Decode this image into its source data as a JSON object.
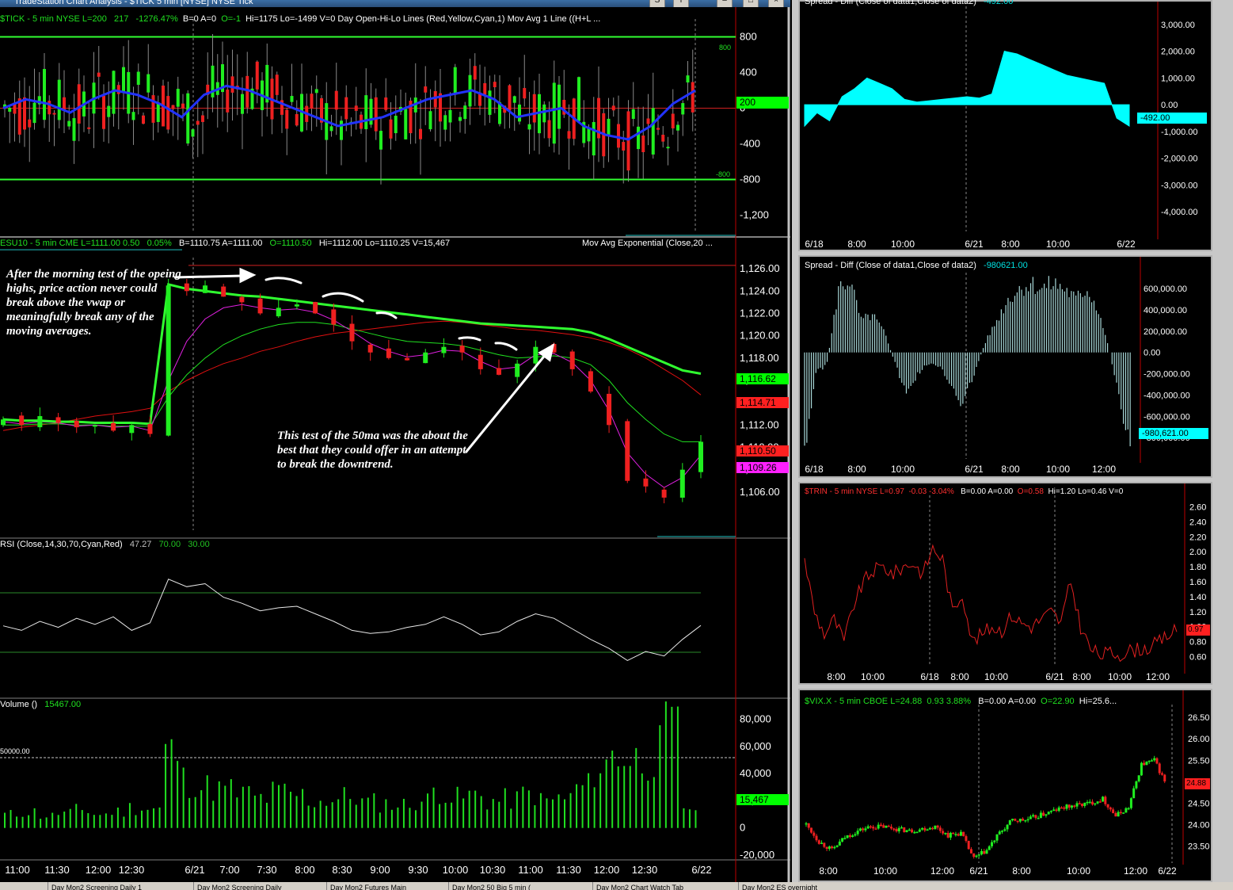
{
  "window": {
    "title": "TradeStation Chart Analysis - $TICK 5 min [NYSE] NYSE Tick",
    "btn_s": "S",
    "btn_i": "i"
  },
  "tabs": [
    "Day Mon2 Screening Daily 1",
    "Day Mon2 Screening Daily",
    "Day Mon2 Futures Main",
    "Day Mon2 50 Big 5 min (",
    "Day Mon2 Chart Watch Tab",
    "Day Mon2 ES overnight"
  ],
  "tick_panel": {
    "header_symbol": "$TICK - 5 min  NYSE  L=200",
    "header_change": "217",
    "header_pct": "-1276.47%",
    "header_rest": "B=0  A=0",
    "header_o": "O=-1",
    "header_hilo": "Hi=1175  Lo=-1499  V=0  Day Open-Hi-Lo Lines (Red,Yellow,Cyan,1)   Mov Avg 1 Line ((H+L ...",
    "ticks": [
      "800",
      "400",
      "0",
      "-400",
      "-800",
      "-1,200"
    ],
    "line_label_top": "800",
    "line_label_bottom": "-800",
    "last_badge": "200"
  },
  "es_panel": {
    "header_symbol": "ESU10 - 5 min  CME  L=1111.00  0.50",
    "header_pct": "0.05%",
    "header_rest": "B=1110.75  A=1111.00",
    "header_o": "O=1110.50",
    "header_hilo": "Hi=1112.00  Lo=1110.25  V=15,467",
    "header_ma": "Mov Avg Exponential (Close,20 ...",
    "ticks": [
      "1,126.00",
      "1,124.00",
      "1,122.00",
      "1,120.00",
      "1,118.00",
      "1,116.00",
      "1,114.00",
      "1,112.00",
      "1,110.00",
      "1,108.00",
      "1,106.00"
    ],
    "badges": {
      "green": "1,116.62",
      "red": "1,114.71",
      "red2": "1,110.50",
      "magenta": "1,109.26"
    },
    "annotation_1": "After the morning test of the opeing highs, price action never could break above the vwap or meaningfully break any of the moving averages.",
    "annotation_2": "This test of the 50ma was the about the best that they could offer in an attempt to break the downtrend."
  },
  "rsi_panel": {
    "header": "RSI (Close,14,30,70,Cyan,Red)",
    "value": "47.27",
    "upper": "70.00",
    "lower": "30.00"
  },
  "vol_panel": {
    "header": "Volume ()",
    "value": "15467.00",
    "ref_label": "50000.00",
    "ticks": [
      "80,000",
      "60,000",
      "40,000",
      "20,000",
      "0",
      "-20,000"
    ],
    "badge": "15,467"
  },
  "left_time_axis": [
    "11:00",
    "11:30",
    "12:00",
    "12:30",
    "6/21",
    "7:00",
    "7:30",
    "8:00",
    "8:30",
    "9:00",
    "9:30",
    "10:00",
    "10:30",
    "11:00",
    "11:30",
    "12:00",
    "12:30",
    "6/22"
  ],
  "spread1": {
    "header": "Spread - Diff (Close of data1,Close of data2)",
    "value": "-492.00",
    "ticks": [
      "3,000.00",
      "2,000.00",
      "1,000.00",
      "0.00",
      "-1,000.00",
      "-2,000.00",
      "-3,000.00",
      "-4,000.00"
    ],
    "badge": "-492.00",
    "time_axis": [
      "6/18",
      "8:00",
      "10:00",
      "6/21",
      "8:00",
      "10:00",
      "6/22"
    ]
  },
  "spread2": {
    "header": "Spread - Diff (Close of data1,Close of data2)",
    "value": "-980621.00",
    "ticks": [
      "600,000.00",
      "400,000.00",
      "200,000.00",
      "0.00",
      "-200,000.00",
      "-400,000.00",
      "-600,000.00",
      "-800,000.00"
    ],
    "badge": "-980,621.00",
    "time_axis": [
      "6/18",
      "8:00",
      "10:00",
      "6/21",
      "8:00",
      "10:00",
      "12:00"
    ]
  },
  "trin": {
    "header_symbol": "$TRIN - 5 min  NYSE  L=0.97",
    "header_chg": "-0.03  -3.04%",
    "header_rest": "B=0.00  A=0.00",
    "header_o": "O=0.58",
    "header_hilo": "Hi=1.20  Lo=0.46  V=0",
    "ticks": [
      "2.60",
      "2.40",
      "2.20",
      "2.00",
      "1.80",
      "1.60",
      "1.40",
      "1.20",
      "1.00",
      "0.80",
      "0.60"
    ],
    "badge": "0.97",
    "time_axis": [
      "8:00",
      "10:00",
      "6/18",
      "8:00",
      "10:00",
      "6/21",
      "8:00",
      "10:00",
      "12:00"
    ]
  },
  "vix": {
    "header_symbol": "$VIX.X - 5 min  CBOE  L=24.88",
    "header_chg": "0.93  3.88%",
    "header_rest": "B=0.00  A=0.00",
    "header_o": "O=22.90",
    "header_hilo": "Hi=25.6...",
    "ticks": [
      "26.50",
      "26.00",
      "25.50",
      "25.00",
      "24.50",
      "24.00",
      "23.50"
    ],
    "badge": "24.88",
    "time_axis": [
      "8:00",
      "10:00",
      "12:00",
      "6/21",
      "8:00",
      "10:00",
      "12:00",
      "6/22"
    ]
  },
  "chart_data": [
    {
      "type": "candlestick",
      "title": "$TICK - 5 min NYSE",
      "ylim": [
        -1400,
        1000
      ],
      "reference_lines": [
        800,
        0,
        -800
      ],
      "moving_average": [
        0,
        100,
        50,
        -50,
        100,
        200,
        150,
        50,
        -100,
        150,
        250,
        200,
        100,
        0,
        -100,
        -200,
        -150,
        -100,
        0,
        100,
        150,
        200,
        100,
        -100,
        -50,
        0,
        -200,
        -300,
        -350,
        -200,
        50,
        200
      ],
      "hi": 1175,
      "lo": -1499,
      "last": 200
    },
    {
      "type": "candlestick",
      "title": "ESU10 - 5 min CME",
      "ylim": [
        1104,
        1127
      ],
      "close": [
        1112.5,
        1112.0,
        1112.8,
        1112.2,
        1111.8,
        1112.0,
        1111.5,
        1112.0,
        1111.2,
        1124.5,
        1124.0,
        1124.5,
        1123.5,
        1123.0,
        1122.0,
        1122.5,
        1122.8,
        1122.0,
        1121.0,
        1119.5,
        1118.5,
        1118.0,
        1117.8,
        1118.5,
        1119.0,
        1118.5,
        1117.0,
        1116.5,
        1117.5,
        1119.0,
        1118.5,
        1117.0,
        1115.0,
        1112.0,
        1107.0,
        1106.5,
        1105.5,
        1108.0,
        1110.5
      ],
      "vwap": [
        1112.5,
        1112.4,
        1112.4,
        1112.3,
        1112.3,
        1112.2,
        1112.2,
        1112.2,
        1112.1,
        1124.6,
        1124.2,
        1124.0,
        1123.8,
        1123.6,
        1123.5,
        1123.3,
        1123.1,
        1122.9,
        1122.7,
        1122.5,
        1122.3,
        1122.1,
        1121.9,
        1121.7,
        1121.5,
        1121.3,
        1121.1,
        1121.0,
        1120.9,
        1120.8,
        1120.7,
        1120.6,
        1120.3,
        1119.7,
        1119.0,
        1118.3,
        1117.6,
        1116.9,
        1116.6
      ],
      "ma_red": [
        1111.5,
        1111.8,
        1112.0,
        1112.2,
        1112.5,
        1112.8,
        1113.0,
        1113.2,
        1113.5,
        1115.0,
        1116.0,
        1116.8,
        1117.5,
        1118.0,
        1118.6,
        1119.0,
        1119.5,
        1119.9,
        1120.2,
        1120.4,
        1120.6,
        1120.8,
        1121.0,
        1121.2,
        1121.3,
        1121.2,
        1121.0,
        1120.8,
        1120.6,
        1120.5,
        1120.3,
        1120.1,
        1119.8,
        1119.4,
        1118.8,
        1118.0,
        1117.0,
        1116.0,
        1114.7
      ],
      "ma_green": [
        1112.0,
        1112.0,
        1112.1,
        1112.1,
        1112.0,
        1112.0,
        1111.9,
        1111.9,
        1111.9,
        1114.5,
        1116.5,
        1118.0,
        1119.2,
        1120.0,
        1120.6,
        1121.0,
        1121.2,
        1121.2,
        1121.0,
        1120.6,
        1120.2,
        1119.8,
        1119.5,
        1119.4,
        1119.3,
        1119.1,
        1118.7,
        1118.3,
        1118.0,
        1118.1,
        1118.2,
        1118.0,
        1117.4,
        1116.0,
        1114.0,
        1112.5,
        1111.2,
        1110.5,
        1110.5
      ],
      "ma_magenta": [
        1112.3,
        1112.1,
        1112.3,
        1112.2,
        1111.9,
        1112.0,
        1111.8,
        1111.9,
        1111.5,
        1116.0,
        1119.5,
        1121.5,
        1122.5,
        1122.8,
        1122.5,
        1122.3,
        1122.4,
        1122.1,
        1121.4,
        1120.4,
        1119.3,
        1118.6,
        1118.1,
        1118.3,
        1118.7,
        1118.6,
        1117.7,
        1117.0,
        1117.2,
        1118.3,
        1118.4,
        1117.6,
        1116.0,
        1113.3,
        1109.5,
        1107.6,
        1106.4,
        1107.3,
        1109.3
      ],
      "last": 1110.5
    },
    {
      "type": "line",
      "title": "RSI (Close,14,30,70,Cyan,Red)",
      "ylim": [
        0,
        100
      ],
      "reference_lines": [
        70,
        30
      ],
      "values": [
        47,
        44,
        50,
        46,
        52,
        48,
        53,
        44,
        49,
        78,
        73,
        75,
        66,
        62,
        57,
        59,
        60,
        55,
        50,
        44,
        42,
        43,
        46,
        48,
        53,
        48,
        41,
        43,
        50,
        55,
        52,
        45,
        38,
        32,
        24,
        30,
        27,
        38,
        47.27
      ],
      "last": 47.27
    },
    {
      "type": "bar",
      "title": "Volume ()",
      "ylim": [
        -20000,
        85000
      ],
      "reference_lines": [
        50000
      ],
      "values": [
        10000,
        12000,
        9000,
        11000,
        13000,
        10000,
        12000,
        15000,
        14000,
        55000,
        35000,
        30000,
        28000,
        25000,
        22000,
        26000,
        24000,
        20000,
        21000,
        23000,
        19000,
        18000,
        17000,
        20000,
        28000,
        22000,
        24000,
        20000,
        21000,
        25000,
        20000,
        22000,
        30000,
        45000,
        55000,
        50000,
        55000,
        70000,
        15467
      ],
      "last": 15467
    },
    {
      "type": "area",
      "title": "Spread - Diff (Close of data1,Close of data2)",
      "ylim": [
        -4500,
        3500
      ],
      "values": [
        -800,
        -300,
        -600,
        300,
        600,
        1000,
        800,
        600,
        200,
        100,
        150,
        200,
        250,
        300,
        250,
        400,
        2000,
        1900,
        1700,
        1500,
        1300,
        1100,
        1000,
        900,
        800,
        -500,
        -800
      ],
      "last": -492
    },
    {
      "type": "bar",
      "title": "Spread - Diff (Close of data1,Close of data2)",
      "ylim": [
        -1000000,
        750000
      ],
      "values": [
        -900000,
        -200000,
        -100000,
        600000,
        680000,
        300000,
        350000,
        200000,
        -100000,
        -400000,
        -200000,
        -100000,
        -150000,
        -300000,
        -500000,
        -200000,
        100000,
        300000,
        500000,
        600000,
        650000,
        600000,
        650000,
        600000,
        500000,
        600000,
        400000,
        0,
        -500000,
        -980621
      ],
      "last": -980621
    },
    {
      "type": "line",
      "title": "$TRIN - 5 min NYSE",
      "ylim": [
        0.5,
        2.7
      ],
      "values": [
        1.9,
        1.2,
        0.9,
        1.1,
        0.8,
        1.3,
        1.6,
        1.75,
        1.8,
        1.7,
        1.8,
        1.85,
        1.7,
        2.05,
        1.9,
        1.2,
        1.45,
        0.8,
        0.9,
        1.0,
        0.95,
        1.15,
        1.05,
        1.0,
        1.1,
        1.2,
        1.05,
        1.6,
        1.0,
        0.7,
        0.62,
        0.65,
        0.63,
        0.68,
        0.7,
        0.72,
        0.8,
        0.9,
        0.97
      ],
      "last": 0.97
    },
    {
      "type": "candlestick",
      "title": "$VIX.X - 5 min CBOE",
      "ylim": [
        23.1,
        26.8
      ],
      "close": [
        24.0,
        23.6,
        23.4,
        23.7,
        23.85,
        23.95,
        23.95,
        23.9,
        23.85,
        23.9,
        23.95,
        23.75,
        23.8,
        23.2,
        23.4,
        23.8,
        24.1,
        24.1,
        24.2,
        24.3,
        24.4,
        24.45,
        24.5,
        24.6,
        24.2,
        24.4,
        25.4,
        25.5,
        24.88
      ],
      "last": 24.88
    }
  ]
}
